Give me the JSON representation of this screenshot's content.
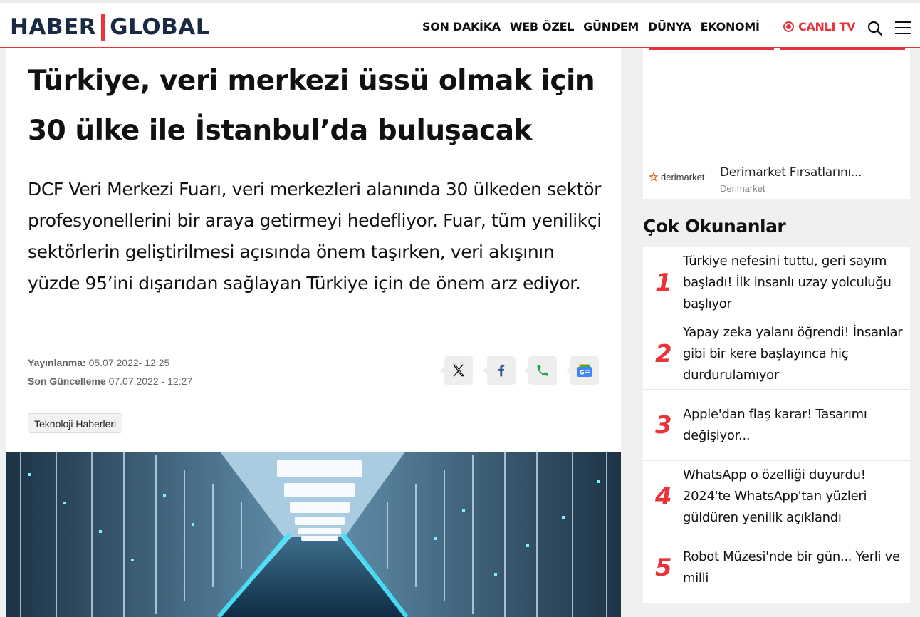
{
  "header": {
    "logo_left": "HABER",
    "logo_right": "GLOBAL",
    "nav": [
      "SON DAKİKA",
      "WEB ÖZEL",
      "GÜNDEM",
      "DÜNYA",
      "EKONOMİ"
    ],
    "live_label": "CANLI TV",
    "accent_color": "#e8333b"
  },
  "article": {
    "title": "Türkiye, veri merkezi üssü olmak için 30 ülke ile İstanbul’da buluşacak",
    "lead": "DCF Veri Merkezi Fuarı, veri merkezleri alanında 30 ülkeden sektör profesyonellerini bir araya getirmeyi hedefliyor. Fuar, tüm yenilikçi sektörlerin geliştirilmesi açısında önem taşırken, veri akışının yüzde 95’ini dışarıdan sağlayan Türkiye için de önem arz ediyor.",
    "published_label": "Yayınlanma:",
    "published_value": "05.07.2022- 12:25",
    "updated_label": "Son Güncelleme",
    "updated_value": "07.07.2022 - 12:27",
    "tag": "Teknoloji Haberleri",
    "share_icons": [
      "x-icon",
      "facebook-icon",
      "phone-icon",
      "google-news-icon"
    ]
  },
  "ad": {
    "brand": "derimarket",
    "title": "Derimarket Fırsatlarını...",
    "sponsor": "Derimarket"
  },
  "popular": {
    "heading": "Çok Okunanlar",
    "items": [
      {
        "num": "1",
        "text": "Türkiye nefesini tuttu, geri sayım başladı! İlk insanlı uzay yolculuğu başlıyor"
      },
      {
        "num": "2",
        "text": "Yapay zeka yalanı öğrendi! İnsanlar gibi bir kere başlayınca hiç durdurulamıyor"
      },
      {
        "num": "3",
        "text": "Apple'dan flaş karar! Tasarımı değişiyor..."
      },
      {
        "num": "4",
        "text": "WhatsApp o özelliği duyurdu! 2024'te WhatsApp'tan yüzleri güldüren yenilik açıklandı"
      },
      {
        "num": "5",
        "text": "Robot Müzesi'nde bir gün... Yerli ve milli"
      }
    ]
  }
}
